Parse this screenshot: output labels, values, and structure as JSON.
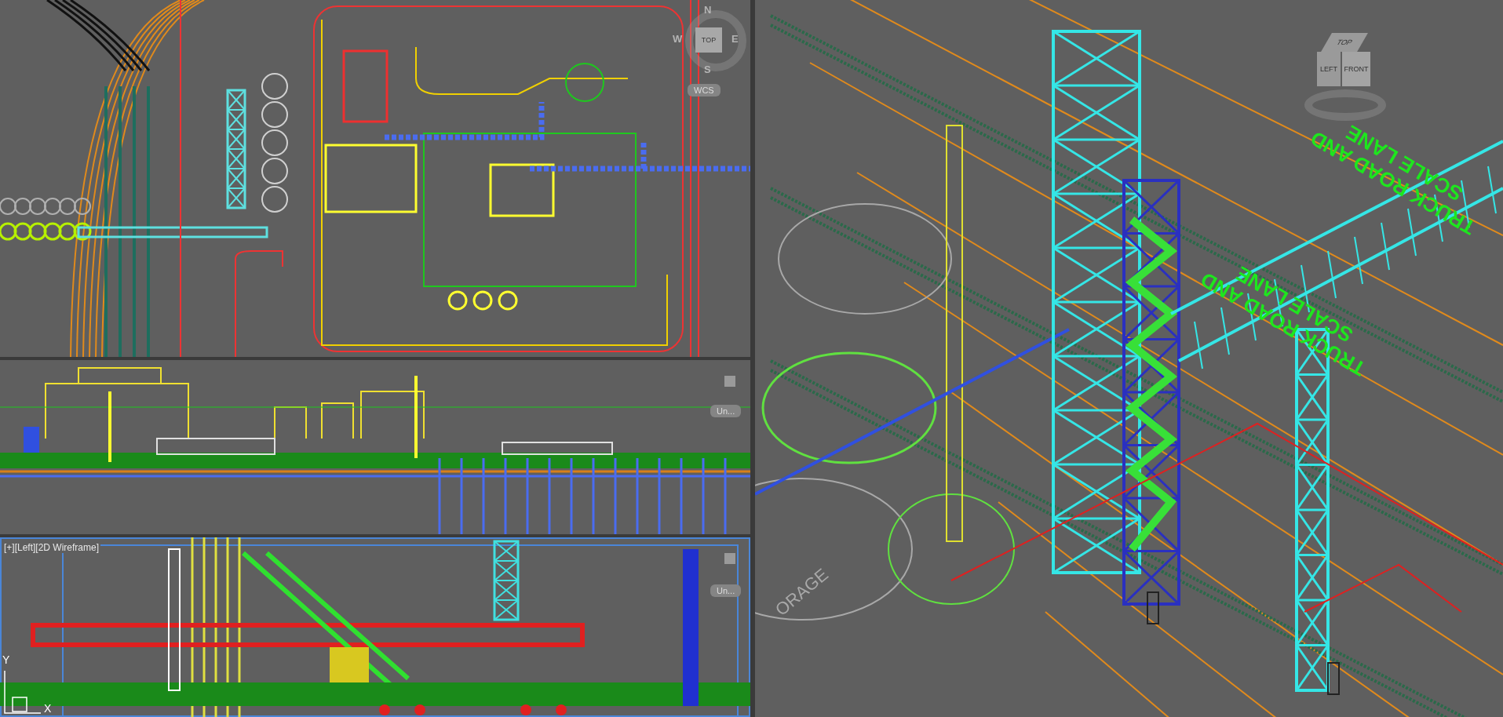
{
  "viewports": [
    {
      "kind": "plan",
      "compass": {
        "north": "N",
        "east": "E",
        "south": "S",
        "west": "W",
        "cube_face": "TOP"
      },
      "ucs_menu": "WCS"
    },
    {
      "kind": "elevation",
      "ucs_menu": "Un..."
    },
    {
      "kind": "side",
      "label": "[+][Left][2D Wireframe]",
      "ucs_menu": "Un...",
      "axes": {
        "y": "Y",
        "x": "X"
      }
    },
    {
      "kind": "iso",
      "cube_faces": {
        "top": "TOP",
        "left": "LEFT",
        "front": "FRONT"
      },
      "lane_labels": [
        "TRUCK ROAD AND SCALE LANE",
        "TRUCK ROAD AND SCALE LANE"
      ],
      "area_text": "ORAGE"
    }
  ]
}
